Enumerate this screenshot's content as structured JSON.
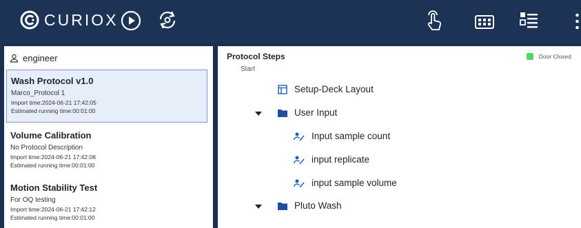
{
  "header": {
    "brand": "CURIOX"
  },
  "user": {
    "name": "engineer"
  },
  "protocols": [
    {
      "title": "Wash Protocol v1.0",
      "description": "Marco_Protocol 1",
      "import_time": "Import time:2024-06-21 17:42:05",
      "running_time": "Estimated running time:00:01:00",
      "selected": true
    },
    {
      "title": "Volume Calibration",
      "description": "No Protocol Description",
      "import_time": "Import time:2024-06-21 17:42:08",
      "running_time": "Estimated running time:00:01:00",
      "selected": false
    },
    {
      "title": "Motion Stability Test",
      "description": "For OQ testing",
      "import_time": "Import time:2024-06-21 17:42:12",
      "running_time": "Estimated running time:00:01:00",
      "selected": false
    }
  ],
  "steps_panel": {
    "title": "Protocol Steps",
    "start_label": "Start",
    "door_status": "Door Closed",
    "door_color": "#4cd964",
    "steps": [
      {
        "label": "Setup-Deck Layout",
        "icon": "layout-icon"
      },
      {
        "label": "User Input",
        "icon": "folder-icon",
        "expanded": true
      },
      {
        "label": "Input sample count",
        "icon": "user-input-icon"
      },
      {
        "label": "input replicate",
        "icon": "user-input-icon"
      },
      {
        "label": "input sample volume",
        "icon": "user-input-icon"
      },
      {
        "label": "Pluto Wash",
        "icon": "folder-icon",
        "expanded": true
      }
    ]
  },
  "colors": {
    "header_bg": "#1d3356",
    "accent": "#1f5fb8",
    "selected_card_bg": "#e8eef9"
  }
}
